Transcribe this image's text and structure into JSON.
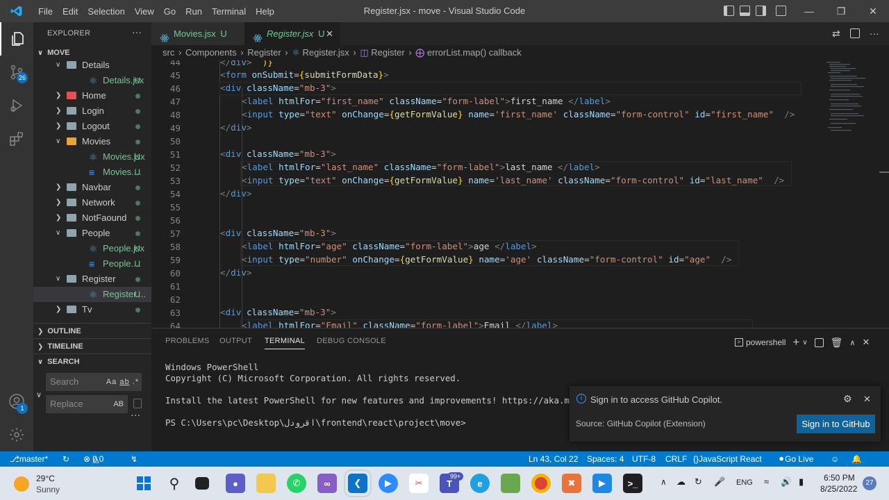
{
  "titlebar": {
    "menu": [
      "File",
      "Edit",
      "Selection",
      "View",
      "Go",
      "Run",
      "Terminal",
      "Help"
    ],
    "title": "Register.jsx - move - Visual Studio Code"
  },
  "activity_badges": {
    "source_control": "26",
    "accounts": "1"
  },
  "explorer": {
    "header": "EXPLORER",
    "root": "MOVE",
    "items": [
      {
        "label": "Details",
        "type": "folder-open",
        "indent": 1,
        "git": ""
      },
      {
        "label": "Details.jsx",
        "type": "react",
        "indent": 2,
        "git": "U"
      },
      {
        "label": "Home",
        "type": "folder-red",
        "indent": 1,
        "git": "dot"
      },
      {
        "label": "Login",
        "type": "folder",
        "indent": 1,
        "git": "dot"
      },
      {
        "label": "Logout",
        "type": "folder",
        "indent": 1,
        "git": "dot"
      },
      {
        "label": "Movies",
        "type": "folder-open-orange",
        "indent": 1,
        "git": "dot"
      },
      {
        "label": "Movies.jsx",
        "type": "react",
        "indent": 2,
        "git": "U"
      },
      {
        "label": "Movies....",
        "type": "css",
        "indent": 2,
        "git": "U"
      },
      {
        "label": "Navbar",
        "type": "folder",
        "indent": 1,
        "git": "dot"
      },
      {
        "label": "Network",
        "type": "folder",
        "indent": 1,
        "git": "dot"
      },
      {
        "label": "NotFaound",
        "type": "folder",
        "indent": 1,
        "git": "dot"
      },
      {
        "label": "People",
        "type": "folder-open",
        "indent": 1,
        "git": "dot"
      },
      {
        "label": "People.jsx",
        "type": "react",
        "indent": 2,
        "git": "U"
      },
      {
        "label": "People....",
        "type": "css",
        "indent": 2,
        "git": "U"
      },
      {
        "label": "Register",
        "type": "folder-open",
        "indent": 1,
        "git": "dot"
      },
      {
        "label": "Register....",
        "type": "react",
        "indent": 2,
        "git": "U",
        "selected": true
      },
      {
        "label": "Tv",
        "type": "folder",
        "indent": 1,
        "git": "dot"
      }
    ],
    "sections": [
      "OUTLINE",
      "TIMELINE",
      "SEARCH"
    ],
    "search_placeholder": "Search",
    "replace_placeholder": "Replace",
    "search_opts": [
      "Aa",
      "ab",
      ".*"
    ],
    "replace_opt": "AB"
  },
  "tabs": [
    {
      "label": "Movies.jsx",
      "status": "U",
      "active": false
    },
    {
      "label": "Register.jsx",
      "status": "U",
      "active": true
    }
  ],
  "breadcrumbs": [
    "src",
    "Components",
    "Register",
    "Register.jsx",
    "Register",
    "errorList.map() callback"
  ],
  "code_lines": [
    "44",
    "45",
    "46",
    "47",
    "48",
    "49",
    "50",
    "51",
    "52",
    "53",
    "54",
    "55",
    "56",
    "57",
    "58",
    "59",
    "60",
    "61",
    "62",
    "63",
    "64"
  ],
  "panel": {
    "tabs": [
      "PROBLEMS",
      "OUTPUT",
      "TERMINAL",
      "DEBUG CONSOLE"
    ],
    "shell": "powershell",
    "terminal_lines": [
      "Windows PowerShell",
      "Copyright (C) Microsoft Corporation. All rights reserved.",
      "",
      "Install the latest PowerShell for new features and improvements! https://aka.ms",
      "",
      "PS C:\\Users\\pc\\Desktop\\اقرودل\\frontend\\react\\project\\move>"
    ]
  },
  "notification": {
    "message": "Sign in to access GitHub Copilot.",
    "source": "Source: GitHub Copilot (Extension)",
    "button": "Sign in to GitHub"
  },
  "statusbar": {
    "branch": "master*",
    "errors": "0",
    "warnings": "0",
    "position": "Ln 43, Col 22",
    "spaces": "Spaces: 4",
    "encoding": "UTF-8",
    "eol": "CRLF",
    "language": "JavaScript React",
    "golive": "Go Live"
  },
  "taskbar": {
    "temp": "29°C",
    "weather": "Sunny",
    "lang": "ENG",
    "time": "6:50 PM",
    "date": "8/25/2022",
    "teams_badge": "99+",
    "notif_count": "27"
  },
  "colors": {
    "accent": "#007acc",
    "react": "#519aba",
    "git_untracked": "#73c991"
  }
}
